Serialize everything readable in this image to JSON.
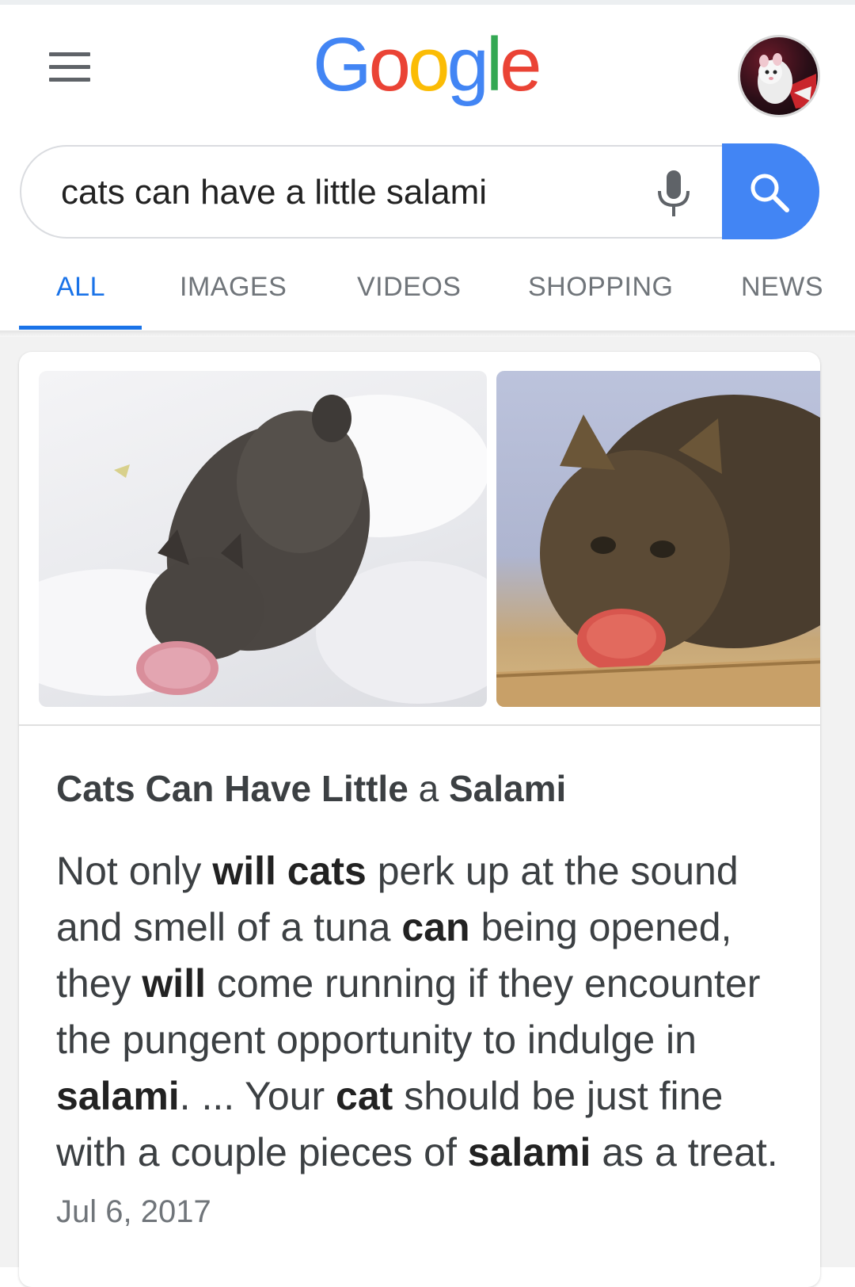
{
  "header": {
    "logo_letters": [
      {
        "ch": "G",
        "color": "#4285f4"
      },
      {
        "ch": "o",
        "color": "#ea4335"
      },
      {
        "ch": "o",
        "color": "#fbbc05"
      },
      {
        "ch": "g",
        "color": "#4285f4"
      },
      {
        "ch": "l",
        "color": "#34a853"
      },
      {
        "ch": "e",
        "color": "#ea4335"
      }
    ]
  },
  "search": {
    "query": "cats can have a little salami"
  },
  "tabs": [
    {
      "label": "ALL",
      "active": true
    },
    {
      "label": "IMAGES",
      "active": false
    },
    {
      "label": "VIDEOS",
      "active": false
    },
    {
      "label": "SHOPPING",
      "active": false
    },
    {
      "label": "NEWS",
      "active": false
    }
  ],
  "result": {
    "title": {
      "part1": "Cats Can Have Little",
      "part2": "a",
      "part3": "Salami"
    },
    "snippet": {
      "s1": "Not only ",
      "b1": "will cats",
      "s2": " perk up at the sound and smell of a tuna ",
      "b2": "can",
      "s3": " being opened, they ",
      "b3": "will",
      "s4": " come running if they encounter the pungent opportunity to indulge in ",
      "b4": "salami",
      "s5": ". ... Your ",
      "b5": "cat",
      "s6": " should be just fine with a couple pieces of ",
      "b6": "salami",
      "s7": " as a treat. "
    },
    "date": "Jul 6, 2017"
  },
  "colors": {
    "accent_blue": "#1a73e8",
    "search_button": "#4285f4"
  }
}
